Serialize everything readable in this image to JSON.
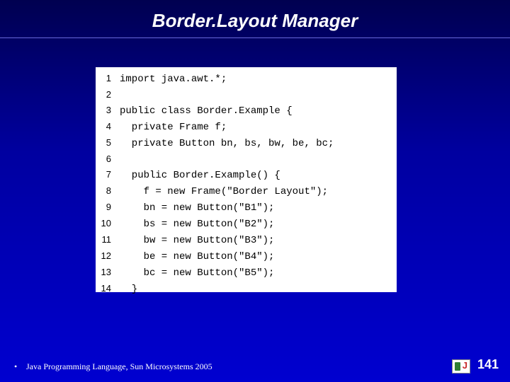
{
  "title": "Border.Layout Manager",
  "code": {
    "lines": [
      {
        "n": "1",
        "t": "import java.awt.*;"
      },
      {
        "n": "2",
        "t": ""
      },
      {
        "n": "3",
        "t": "public class Border.Example {"
      },
      {
        "n": "4",
        "t": "  private Frame f;"
      },
      {
        "n": "5",
        "t": "  private Button bn, bs, bw, be, bc;"
      },
      {
        "n": "6",
        "t": ""
      },
      {
        "n": "7",
        "t": "  public Border.Example() {"
      },
      {
        "n": "8",
        "t": "    f = new Frame(\"Border Layout\");"
      },
      {
        "n": "9",
        "t": "    bn = new Button(\"B1\");"
      },
      {
        "n": "10",
        "t": "    bs = new Button(\"B2\");"
      },
      {
        "n": "11",
        "t": "    bw = new Button(\"B3\");"
      },
      {
        "n": "12",
        "t": "    be = new Button(\"B4\");"
      },
      {
        "n": "13",
        "t": "    bc = new Button(\"B5\");"
      },
      {
        "n": "14",
        "t": "  }"
      }
    ]
  },
  "footer": {
    "bullet": "•",
    "text": "Java Programming Language, Sun Microsystems 2005"
  },
  "page_number": "141"
}
